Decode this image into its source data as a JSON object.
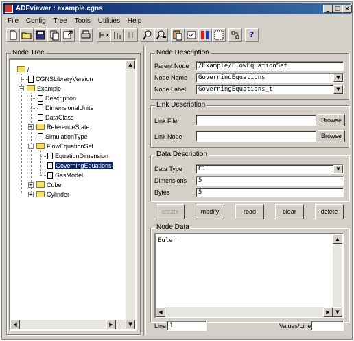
{
  "window": {
    "title": "ADFviewer : example.cgns"
  },
  "menu": [
    "File",
    "Config",
    "Tree",
    "Tools",
    "Utilities",
    "Help"
  ],
  "toolbar": {
    "icons": [
      "new-file-icon",
      "open-folder-icon",
      "save-icon",
      "copy-file-icon",
      "export-icon",
      "print-icon",
      "move-node-icon",
      "reorder-icon",
      "number-icon",
      "find-icon",
      "find-next-icon",
      "paste-icon",
      "check-icon",
      "plot-icon",
      "grid-icon",
      "merge-icon",
      "help-icon"
    ],
    "help_glyph": "?"
  },
  "node_tree": {
    "title": "Node Tree",
    "items": {
      "root": "/",
      "cgns_version": "CGNSLibraryVersion",
      "example": "Example",
      "description": "Description",
      "dimensional_units": "DimensionalUnits",
      "data_class": "DataClass",
      "reference_state": "ReferenceState",
      "simulation_type": "SimulationType",
      "flow_equation_set": "FlowEquationSet",
      "equation_dimension": "EquationDimension",
      "governing_equations": "GoverningEquations",
      "gas_model": "GasModel",
      "cube": "Cube",
      "cylinder": "Cylinder"
    }
  },
  "node_description": {
    "title": "Node Description",
    "parent_node_label": "Parent Node",
    "parent_node_value": "/Example/FlowEquationSet",
    "node_name_label": "Node Name",
    "node_name_value": "GoverningEquations",
    "node_label_label": "Node Label",
    "node_label_value": "GoverningEquations_t"
  },
  "link_description": {
    "title": "Link Description",
    "link_file_label": "Link File",
    "link_file_value": "",
    "link_node_label": "Link Node",
    "link_node_value": "",
    "browse_label": "Browse"
  },
  "data_description": {
    "title": "Data Description",
    "data_type_label": "Data Type",
    "data_type_value": "C1",
    "dimensions_label": "Dimensions",
    "dimensions_value": "5",
    "bytes_label": "Bytes",
    "bytes_value": "5"
  },
  "actions": {
    "create": "create",
    "modify": "modify",
    "read": "read",
    "clear": "clear",
    "delete": "delete"
  },
  "node_data": {
    "title": "Node Data",
    "content": "Euler",
    "line_label": "Line",
    "line_value": "1",
    "values_per_line_label": "Values/Line",
    "values_per_line_value": ""
  }
}
